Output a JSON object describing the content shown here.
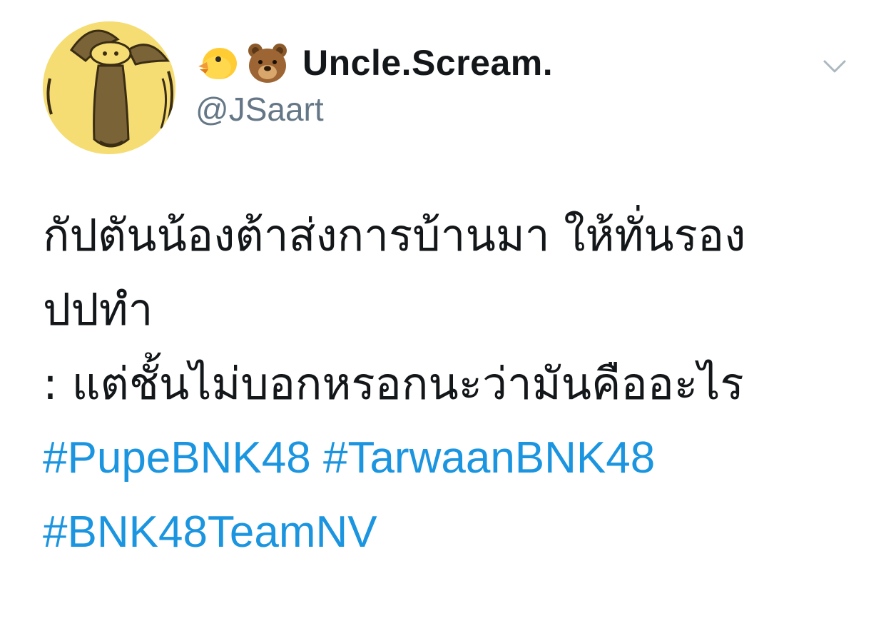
{
  "tweet": {
    "display_name": "Uncle.Scream.",
    "handle": "@JSaart",
    "name_emojis": [
      "chick-emoji",
      "bear-face-emoji"
    ],
    "text_lines": [
      "กัปตันน้องต้าส่งการบ้านมา ให้ทั่นรอง",
      "ปปทำ",
      ": แต่ชั้นไม่บอกหรอกนะว่ามันคืออะไร"
    ],
    "hashtags": [
      "#PupeBNK48",
      "#TarwaanBNK48",
      "#BNK48TeamNV"
    ],
    "colors": {
      "hashtag": "#1b95e0",
      "handle": "#657786",
      "avatar_bg": "#f5dd74"
    },
    "icons": {
      "menu": "chevron-down-icon"
    }
  }
}
